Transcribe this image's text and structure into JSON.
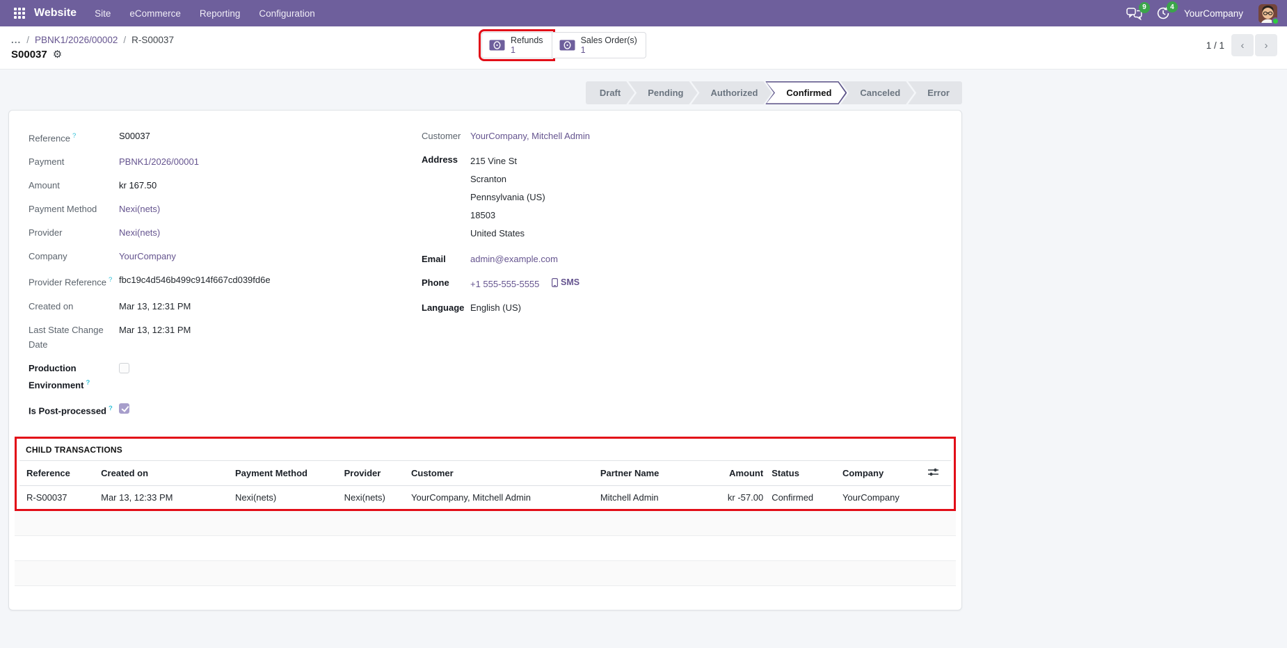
{
  "help_marker": "?",
  "colors": {
    "navbar": "#6e5f9c",
    "link": "#65548f",
    "badge_green": "#3ba44b",
    "annotation_red": "#e20e18",
    "page_bg": "#f4f6f9"
  },
  "icons": {
    "apps": "grid-3x3",
    "messages": "speech-bubbles",
    "activities": "clock",
    "smart_button": "money-bill",
    "settings": "gear",
    "sms": "mobile-phone",
    "optional_columns": "sliders",
    "pager_prev": "chevron-left",
    "pager_next": "chevron-right"
  },
  "navbar": {
    "app_name": "Website",
    "menus": [
      "Site",
      "eCommerce",
      "Reporting",
      "Configuration"
    ],
    "messages_badge": "9",
    "activities_badge": "4",
    "company": "YourCompany"
  },
  "control_panel": {
    "breadcrumb": {
      "ellipsis": "...",
      "separator": "/",
      "parent": "PBNK1/2026/00002",
      "current": "R-S00037"
    },
    "title": "S00037",
    "smart_buttons": [
      {
        "label": "Refunds",
        "count": "1"
      },
      {
        "label": "Sales Order(s)",
        "count": "1"
      }
    ],
    "pager": {
      "value": "1 / 1",
      "prev": "‹",
      "next": "›"
    }
  },
  "statusbar": {
    "steps": [
      "Draft",
      "Pending",
      "Authorized",
      "Confirmed",
      "Canceled",
      "Error"
    ],
    "active": "Confirmed"
  },
  "form": {
    "left": [
      {
        "label": "Reference",
        "value": "S00037"
      },
      {
        "label": "Payment",
        "value": "PBNK1/2026/00001"
      },
      {
        "label": "Amount",
        "value": "kr 167.50"
      },
      {
        "label": "Payment Method",
        "value": "Nexi(nets)"
      },
      {
        "label": "Provider",
        "value": "Nexi(nets)"
      },
      {
        "label": "Company",
        "value": "YourCompany"
      },
      {
        "label": "Provider Reference",
        "value": "fbc19c4d546b499c914f667cd039fd6e"
      },
      {
        "label": "Created on",
        "value": "Mar 13, 12:31 PM"
      },
      {
        "label": "Last State Change Date",
        "value": "Mar 13, 12:31 PM"
      },
      {
        "label": "Production Environment",
        "checked": false
      },
      {
        "label": "Is Post-processed",
        "checked": true
      }
    ],
    "right": {
      "customer": {
        "label": "Customer",
        "value": "YourCompany, Mitchell Admin"
      },
      "address": {
        "label": "Address",
        "lines": [
          "215 Vine St",
          "Scranton",
          "Pennsylvania (US)",
          "18503",
          "United States"
        ]
      },
      "email": {
        "label": "Email",
        "value": "admin@example.com"
      },
      "phone": {
        "label": "Phone",
        "value": "+1 555-555-5555",
        "sms": "SMS"
      },
      "language": {
        "label": "Language",
        "value": "English (US)"
      }
    }
  },
  "child_transactions": {
    "title": "CHILD TRANSACTIONS",
    "headers": [
      "Reference",
      "Created on",
      "Payment Method",
      "Provider",
      "Customer",
      "Partner Name",
      "Amount",
      "Status",
      "Company"
    ],
    "rows": [
      [
        "R-S00037",
        "Mar 13, 12:33 PM",
        "Nexi(nets)",
        "Nexi(nets)",
        "YourCompany, Mitchell Admin",
        "Mitchell Admin",
        "kr -57.00",
        "Confirmed",
        "YourCompany"
      ]
    ]
  }
}
